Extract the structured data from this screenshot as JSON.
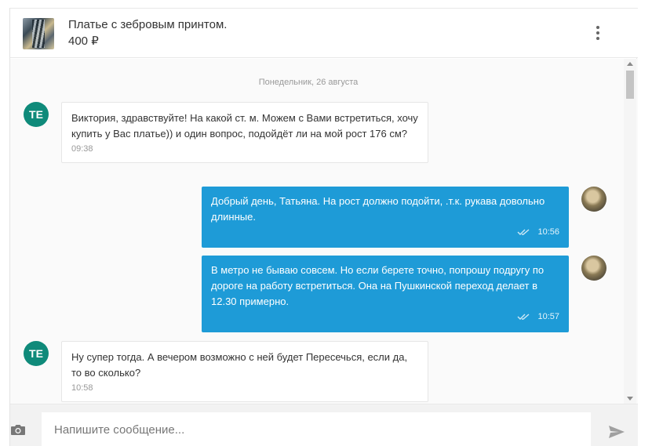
{
  "header": {
    "product_title": "Платье с зебровым принтом.",
    "product_price": "400 ₽",
    "menu_icon": "more-vertical-icon"
  },
  "chat": {
    "date_separator": "Понедельник, 26 августа",
    "messages": [
      {
        "direction": "incoming",
        "avatar_initials": "ТЕ",
        "text": "Виктория, здравствуйте! На какой ст. м. Можем с Вами встретиться, хочу купить у Вас платье)) и один вопрос, подойдёт ли на мой рост 176 см?",
        "time": "09:38"
      },
      {
        "direction": "outgoing",
        "text": "Добрый день, Татьяна. На рост должно подойти, .т.к. рукава довольно длинные.",
        "time": "10:56",
        "status_icon": "double-check-icon"
      },
      {
        "direction": "outgoing",
        "text": "В метро не бываю совсем. Но если берете точно, попрошу подругу по дороге на работу встретиться. Она на Пушкинской переход делает в 12.30 примерно.",
        "time": "10:57",
        "status_icon": "double-check-icon"
      },
      {
        "direction": "incoming",
        "avatar_initials": "ТЕ",
        "text": "Ну супер тогда. А вечером возможно с ней будет Пересечься, если да, то во сколько?",
        "time": "10:58"
      }
    ]
  },
  "composer": {
    "placeholder": "Напишите сообщение...",
    "camera_icon": "camera-icon",
    "send_icon": "send-icon"
  },
  "colors": {
    "outgoing_bubble": "#1e9bd7",
    "avatar_te": "#0f8a7a"
  }
}
